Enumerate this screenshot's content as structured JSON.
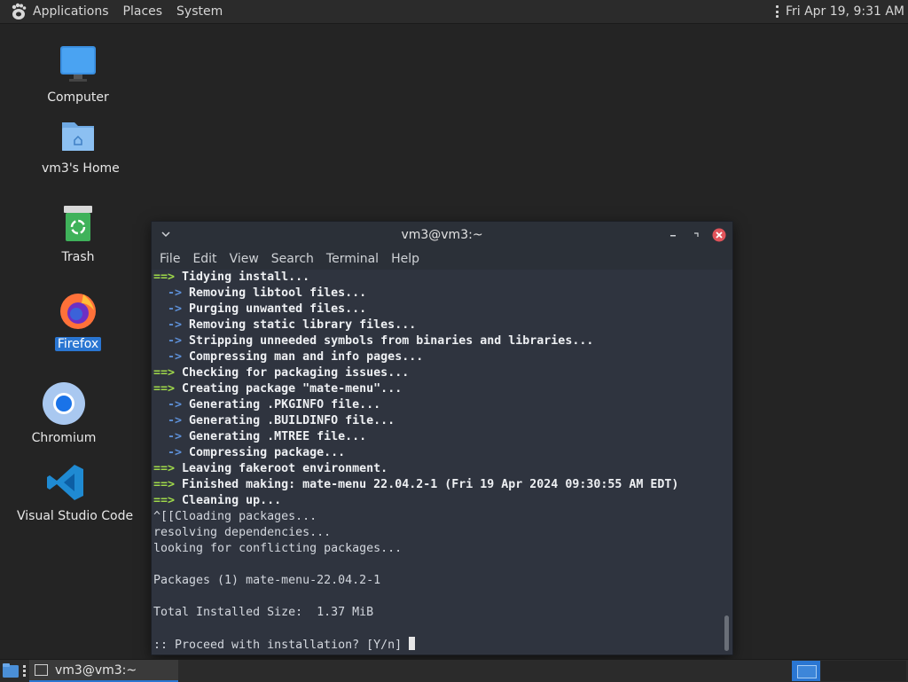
{
  "top_panel": {
    "menus": [
      "Applications",
      "Places",
      "System"
    ],
    "clock": "Fri Apr 19,  9:31 AM"
  },
  "desktop": {
    "icons": [
      {
        "label": "Computer",
        "icon": "computer-icon"
      },
      {
        "label": "vm3's Home",
        "icon": "home-folder-icon"
      },
      {
        "label": "Trash",
        "icon": "trash-icon"
      },
      {
        "label": "Firefox",
        "icon": "firefox-icon",
        "selected": true
      },
      {
        "label": "Chromium",
        "icon": "chromium-icon"
      },
      {
        "label": "Visual Studio Code",
        "icon": "vscode-icon"
      }
    ]
  },
  "terminal": {
    "title": "vm3@vm3:~",
    "menu": [
      "File",
      "Edit",
      "View",
      "Search",
      "Terminal",
      "Help"
    ],
    "lines": [
      {
        "kind": "main",
        "text": "Tidying install..."
      },
      {
        "kind": "sub",
        "text": "Removing libtool files..."
      },
      {
        "kind": "sub",
        "text": "Purging unwanted files..."
      },
      {
        "kind": "sub",
        "text": "Removing static library files..."
      },
      {
        "kind": "sub",
        "text": "Stripping unneeded symbols from binaries and libraries..."
      },
      {
        "kind": "sub",
        "text": "Compressing man and info pages..."
      },
      {
        "kind": "main",
        "text": "Checking for packaging issues..."
      },
      {
        "kind": "main",
        "text": "Creating package \"mate-menu\"..."
      },
      {
        "kind": "sub",
        "text": "Generating .PKGINFO file..."
      },
      {
        "kind": "sub",
        "text": "Generating .BUILDINFO file..."
      },
      {
        "kind": "sub",
        "text": "Generating .MTREE file..."
      },
      {
        "kind": "sub",
        "text": "Compressing package..."
      },
      {
        "kind": "main",
        "text": "Leaving fakeroot environment."
      },
      {
        "kind": "main",
        "text": "Finished making: mate-menu 22.04.2-1 (Fri 19 Apr 2024 09:30:55 AM EDT)"
      },
      {
        "kind": "main",
        "text": "Cleaning up..."
      },
      {
        "kind": "plain",
        "text": "^[[Cloading packages..."
      },
      {
        "kind": "plain",
        "text": "resolving dependencies..."
      },
      {
        "kind": "plain",
        "text": "looking for conflicting packages..."
      },
      {
        "kind": "plain",
        "text": ""
      },
      {
        "kind": "plain",
        "text": "Packages (1) mate-menu-22.04.2-1"
      },
      {
        "kind": "plain",
        "text": ""
      },
      {
        "kind": "plain",
        "text": "Total Installed Size:  1.37 MiB"
      },
      {
        "kind": "plain",
        "text": ""
      },
      {
        "kind": "prompt",
        "text": ":: Proceed with installation? [Y/n] "
      }
    ]
  },
  "taskbar": {
    "task_label": "vm3@vm3:~"
  }
}
